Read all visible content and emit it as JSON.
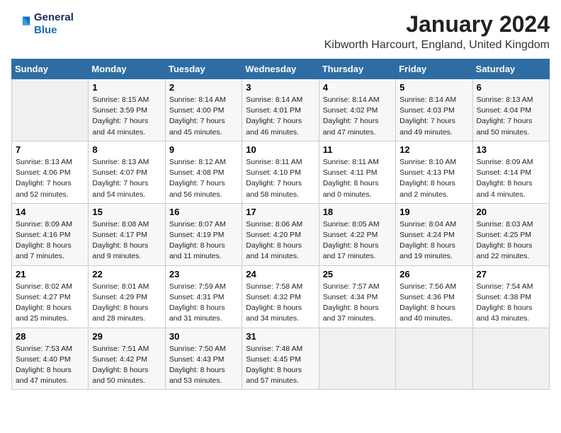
{
  "logo": {
    "line1": "General",
    "line2": "Blue"
  },
  "title": "January 2024",
  "location": "Kibworth Harcourt, England, United Kingdom",
  "days_of_week": [
    "Sunday",
    "Monday",
    "Tuesday",
    "Wednesday",
    "Thursday",
    "Friday",
    "Saturday"
  ],
  "weeks": [
    [
      {
        "day": "",
        "sunrise": "",
        "sunset": "",
        "daylight": ""
      },
      {
        "day": "1",
        "sunrise": "Sunrise: 8:15 AM",
        "sunset": "Sunset: 3:59 PM",
        "daylight": "Daylight: 7 hours and 44 minutes."
      },
      {
        "day": "2",
        "sunrise": "Sunrise: 8:14 AM",
        "sunset": "Sunset: 4:00 PM",
        "daylight": "Daylight: 7 hours and 45 minutes."
      },
      {
        "day": "3",
        "sunrise": "Sunrise: 8:14 AM",
        "sunset": "Sunset: 4:01 PM",
        "daylight": "Daylight: 7 hours and 46 minutes."
      },
      {
        "day": "4",
        "sunrise": "Sunrise: 8:14 AM",
        "sunset": "Sunset: 4:02 PM",
        "daylight": "Daylight: 7 hours and 47 minutes."
      },
      {
        "day": "5",
        "sunrise": "Sunrise: 8:14 AM",
        "sunset": "Sunset: 4:03 PM",
        "daylight": "Daylight: 7 hours and 49 minutes."
      },
      {
        "day": "6",
        "sunrise": "Sunrise: 8:13 AM",
        "sunset": "Sunset: 4:04 PM",
        "daylight": "Daylight: 7 hours and 50 minutes."
      }
    ],
    [
      {
        "day": "7",
        "sunrise": "Sunrise: 8:13 AM",
        "sunset": "Sunset: 4:06 PM",
        "daylight": "Daylight: 7 hours and 52 minutes."
      },
      {
        "day": "8",
        "sunrise": "Sunrise: 8:13 AM",
        "sunset": "Sunset: 4:07 PM",
        "daylight": "Daylight: 7 hours and 54 minutes."
      },
      {
        "day": "9",
        "sunrise": "Sunrise: 8:12 AM",
        "sunset": "Sunset: 4:08 PM",
        "daylight": "Daylight: 7 hours and 56 minutes."
      },
      {
        "day": "10",
        "sunrise": "Sunrise: 8:11 AM",
        "sunset": "Sunset: 4:10 PM",
        "daylight": "Daylight: 7 hours and 58 minutes."
      },
      {
        "day": "11",
        "sunrise": "Sunrise: 8:11 AM",
        "sunset": "Sunset: 4:11 PM",
        "daylight": "Daylight: 8 hours and 0 minutes."
      },
      {
        "day": "12",
        "sunrise": "Sunrise: 8:10 AM",
        "sunset": "Sunset: 4:13 PM",
        "daylight": "Daylight: 8 hours and 2 minutes."
      },
      {
        "day": "13",
        "sunrise": "Sunrise: 8:09 AM",
        "sunset": "Sunset: 4:14 PM",
        "daylight": "Daylight: 8 hours and 4 minutes."
      }
    ],
    [
      {
        "day": "14",
        "sunrise": "Sunrise: 8:09 AM",
        "sunset": "Sunset: 4:16 PM",
        "daylight": "Daylight: 8 hours and 7 minutes."
      },
      {
        "day": "15",
        "sunrise": "Sunrise: 8:08 AM",
        "sunset": "Sunset: 4:17 PM",
        "daylight": "Daylight: 8 hours and 9 minutes."
      },
      {
        "day": "16",
        "sunrise": "Sunrise: 8:07 AM",
        "sunset": "Sunset: 4:19 PM",
        "daylight": "Daylight: 8 hours and 11 minutes."
      },
      {
        "day": "17",
        "sunrise": "Sunrise: 8:06 AM",
        "sunset": "Sunset: 4:20 PM",
        "daylight": "Daylight: 8 hours and 14 minutes."
      },
      {
        "day": "18",
        "sunrise": "Sunrise: 8:05 AM",
        "sunset": "Sunset: 4:22 PM",
        "daylight": "Daylight: 8 hours and 17 minutes."
      },
      {
        "day": "19",
        "sunrise": "Sunrise: 8:04 AM",
        "sunset": "Sunset: 4:24 PM",
        "daylight": "Daylight: 8 hours and 19 minutes."
      },
      {
        "day": "20",
        "sunrise": "Sunrise: 8:03 AM",
        "sunset": "Sunset: 4:25 PM",
        "daylight": "Daylight: 8 hours and 22 minutes."
      }
    ],
    [
      {
        "day": "21",
        "sunrise": "Sunrise: 8:02 AM",
        "sunset": "Sunset: 4:27 PM",
        "daylight": "Daylight: 8 hours and 25 minutes."
      },
      {
        "day": "22",
        "sunrise": "Sunrise: 8:01 AM",
        "sunset": "Sunset: 4:29 PM",
        "daylight": "Daylight: 8 hours and 28 minutes."
      },
      {
        "day": "23",
        "sunrise": "Sunrise: 7:59 AM",
        "sunset": "Sunset: 4:31 PM",
        "daylight": "Daylight: 8 hours and 31 minutes."
      },
      {
        "day": "24",
        "sunrise": "Sunrise: 7:58 AM",
        "sunset": "Sunset: 4:32 PM",
        "daylight": "Daylight: 8 hours and 34 minutes."
      },
      {
        "day": "25",
        "sunrise": "Sunrise: 7:57 AM",
        "sunset": "Sunset: 4:34 PM",
        "daylight": "Daylight: 8 hours and 37 minutes."
      },
      {
        "day": "26",
        "sunrise": "Sunrise: 7:56 AM",
        "sunset": "Sunset: 4:36 PM",
        "daylight": "Daylight: 8 hours and 40 minutes."
      },
      {
        "day": "27",
        "sunrise": "Sunrise: 7:54 AM",
        "sunset": "Sunset: 4:38 PM",
        "daylight": "Daylight: 8 hours and 43 minutes."
      }
    ],
    [
      {
        "day": "28",
        "sunrise": "Sunrise: 7:53 AM",
        "sunset": "Sunset: 4:40 PM",
        "daylight": "Daylight: 8 hours and 47 minutes."
      },
      {
        "day": "29",
        "sunrise": "Sunrise: 7:51 AM",
        "sunset": "Sunset: 4:42 PM",
        "daylight": "Daylight: 8 hours and 50 minutes."
      },
      {
        "day": "30",
        "sunrise": "Sunrise: 7:50 AM",
        "sunset": "Sunset: 4:43 PM",
        "daylight": "Daylight: 8 hours and 53 minutes."
      },
      {
        "day": "31",
        "sunrise": "Sunrise: 7:48 AM",
        "sunset": "Sunset: 4:45 PM",
        "daylight": "Daylight: 8 hours and 57 minutes."
      },
      {
        "day": "",
        "sunrise": "",
        "sunset": "",
        "daylight": ""
      },
      {
        "day": "",
        "sunrise": "",
        "sunset": "",
        "daylight": ""
      },
      {
        "day": "",
        "sunrise": "",
        "sunset": "",
        "daylight": ""
      }
    ]
  ]
}
